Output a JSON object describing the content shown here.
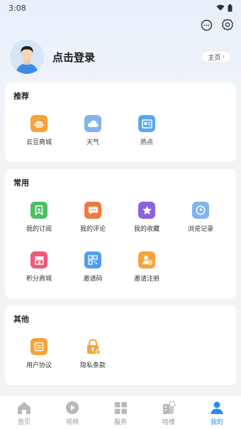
{
  "status_bar": {
    "time": "3:08"
  },
  "profile": {
    "login_label": "点击登录",
    "home_label": "主页"
  },
  "sections": [
    {
      "title": "推荐",
      "items": [
        {
          "label": "云豆商城",
          "icon": "store-icon",
          "color": "#f5a33a"
        },
        {
          "label": "天气",
          "icon": "weather-icon",
          "color": "#7fb4ef"
        },
        {
          "label": "热点",
          "icon": "news-icon",
          "color": "#5aa6f0"
        }
      ]
    },
    {
      "title": "常用",
      "items": [
        {
          "label": "我的订阅",
          "icon": "subscribe-icon",
          "color": "#4cbf63"
        },
        {
          "label": "我的评论",
          "icon": "comment-icon",
          "color": "#f07a3e"
        },
        {
          "label": "我的收藏",
          "icon": "star-icon",
          "color": "#8a63e0"
        },
        {
          "label": "浏览记录",
          "icon": "history-icon",
          "color": "#7fb4ef"
        },
        {
          "label": "积分商城",
          "icon": "points-store-icon",
          "color": "#ef5a7a"
        },
        {
          "label": "邀请码",
          "icon": "qr-code-icon",
          "color": "#4f9cf0"
        },
        {
          "label": "邀请注册",
          "icon": "invite-register-icon",
          "color": "#f5a33a"
        }
      ]
    },
    {
      "title": "其他",
      "items": [
        {
          "label": "用户协议",
          "icon": "agreement-icon",
          "color": "#f5a33a"
        },
        {
          "label": "隐私条款",
          "icon": "privacy-lock-icon",
          "color": "#f5a33a"
        }
      ]
    }
  ],
  "tabbar": [
    {
      "label": "首页",
      "icon": "home-icon",
      "active": false
    },
    {
      "label": "视频",
      "icon": "video-icon",
      "active": false
    },
    {
      "label": "服务",
      "icon": "services-grid-icon",
      "active": false
    },
    {
      "label": "哈楼",
      "icon": "building-icon",
      "active": false
    },
    {
      "label": "我的",
      "icon": "profile-icon",
      "active": true
    }
  ],
  "colors": {
    "accent": "#2b8cf0",
    "inactive": "#b8b8b8"
  }
}
